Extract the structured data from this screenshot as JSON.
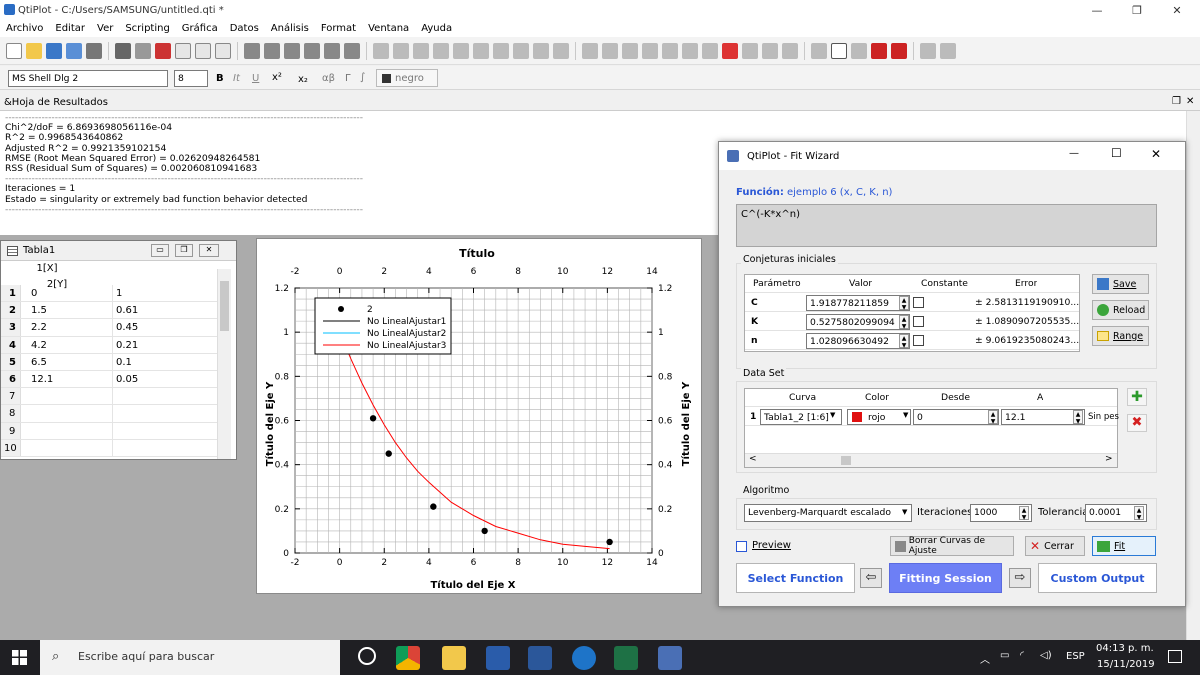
{
  "window": {
    "title": "QtiPlot - C:/Users/SAMSUNG/untitled.qti *"
  },
  "menu": [
    "Archivo",
    "Editar",
    "Ver",
    "Scripting",
    "Gráfica",
    "Datos",
    "Análisis",
    "Format",
    "Ventana",
    "Ayuda"
  ],
  "format_bar": {
    "font": "MS Shell Dlg 2",
    "size": "8",
    "bold": "B",
    "italic": "It",
    "underline": "U",
    "sup": "x²",
    "sub": "x₂",
    "greek": "αβ",
    "gamma": "Γ",
    "integral": "∫",
    "color_label": "negro"
  },
  "results": {
    "title": "&Hoja de Resultados",
    "lines": [
      "Chi^2/doF = 6.8693698056116e-04",
      "R^2 = 0.9968543640862",
      "Adjusted R^2 = 0.9921359102154",
      "RMSE (Root Mean Squared Error) = 0.02620948264581",
      "RSS (Residual Sum of Squares) = 0.002060810941683"
    ],
    "lines2": [
      "Iteraciones = 1",
      "Estado = singularity or extremely bad function behavior detected"
    ]
  },
  "table": {
    "title": "Tabla1",
    "headers": [
      "1[X]",
      "2[Y]"
    ],
    "rows": [
      [
        "1",
        "0",
        "1"
      ],
      [
        "2",
        "1.5",
        "0.61"
      ],
      [
        "3",
        "2.2",
        "0.45"
      ],
      [
        "4",
        "4.2",
        "0.21"
      ],
      [
        "5",
        "6.5",
        "0.1"
      ],
      [
        "6",
        "12.1",
        "0.05"
      ],
      [
        "7",
        "",
        ""
      ],
      [
        "8",
        "",
        ""
      ],
      [
        "9",
        "",
        ""
      ],
      [
        "10",
        "",
        ""
      ]
    ]
  },
  "graph": {
    "title": "Título",
    "xlabel": "Título del Eje X",
    "ylabel": "Título del Eje Y",
    "ylabel_right": "Título del Eje Y",
    "legend": [
      "2",
      "No LinealAjustar1",
      "No LinealAjustar2",
      "No LinealAjustar3"
    ],
    "colors": {
      "series": "#000000",
      "fit1": "#000000",
      "fit2": "#00bfff",
      "fit3": "#ff0000"
    }
  },
  "chart_data": {
    "type": "scatter",
    "title": "Título",
    "xlabel": "Título del Eje X",
    "ylabel": "Título del Eje Y",
    "xlim": [
      -2,
      14
    ],
    "ylim": [
      0,
      1.2
    ],
    "xticks": [
      "-2",
      "0",
      "2",
      "4",
      "6",
      "8",
      "10",
      "12",
      "14"
    ],
    "yticks": [
      "0",
      "0.2",
      "0.4",
      "0.6",
      "0.8",
      "1",
      "1.2"
    ],
    "grid": true,
    "legend_position": "top-left",
    "series": [
      {
        "name": "2",
        "type": "scatter",
        "x": [
          0,
          1.5,
          2.2,
          4.2,
          6.5,
          12.1
        ],
        "y": [
          1,
          0.61,
          0.45,
          0.21,
          0.1,
          0.05
        ]
      },
      {
        "name": "No LinealAjustar3",
        "type": "line",
        "x": [
          0,
          0.5,
          1,
          1.5,
          2,
          2.5,
          3,
          3.5,
          4,
          5,
          6,
          7,
          8,
          9,
          10,
          11,
          12.1
        ],
        "y": [
          1,
          0.88,
          0.77,
          0.67,
          0.58,
          0.5,
          0.43,
          0.37,
          0.32,
          0.23,
          0.17,
          0.12,
          0.09,
          0.06,
          0.04,
          0.03,
          0.02
        ]
      }
    ]
  },
  "wizard": {
    "title": "QtiPlot - Fit Wizard",
    "function_label": "Función:",
    "function_name": "ejemplo 6 (x, C, K, n)",
    "formula": "C^(-K*x^n)",
    "initial_title": "Conjeturas iniciales",
    "param_headers": [
      "Parámetro",
      "Valor",
      "Constante",
      "Error"
    ],
    "params": [
      {
        "name": "C",
        "value": "1.918778211859",
        "error": "± 2.5813119190910..."
      },
      {
        "name": "K",
        "value": "0.5275802099094",
        "error": "± 1.0890907205535..."
      },
      {
        "name": "n",
        "value": "1.028096630492",
        "error": "± 9.0619235080243..."
      }
    ],
    "save": "Save",
    "reload": "Reload",
    "range": "Range",
    "dataset_title": "Data Set",
    "ds_headers": [
      "Curva",
      "Color",
      "Desde",
      "A"
    ],
    "dataset": {
      "index": "1",
      "curve": "Tabla1_2 [1:6]",
      "color": "rojo",
      "from": "0",
      "to": "12.1",
      "extra": "Sin pes"
    },
    "algo_title": "Algoritmo",
    "algorithm": "Levenberg-Marquardt escalado",
    "iter_label": "Iteraciones",
    "iterations": "1000",
    "tol_label": "Tolerancia",
    "tolerance": "0.0001",
    "preview": "Preview",
    "clear": "Borrar Curvas de Ajuste",
    "cancel": "Cerrar",
    "fit": "Fit",
    "select_function": "Select Function",
    "fitting_session": "Fitting Session",
    "custom_output": "Custom Output"
  },
  "taskbar": {
    "search": "Escribe aquí para buscar",
    "lang": "ESP",
    "time": "04:13 p. m.",
    "date": "15/11/2019"
  }
}
